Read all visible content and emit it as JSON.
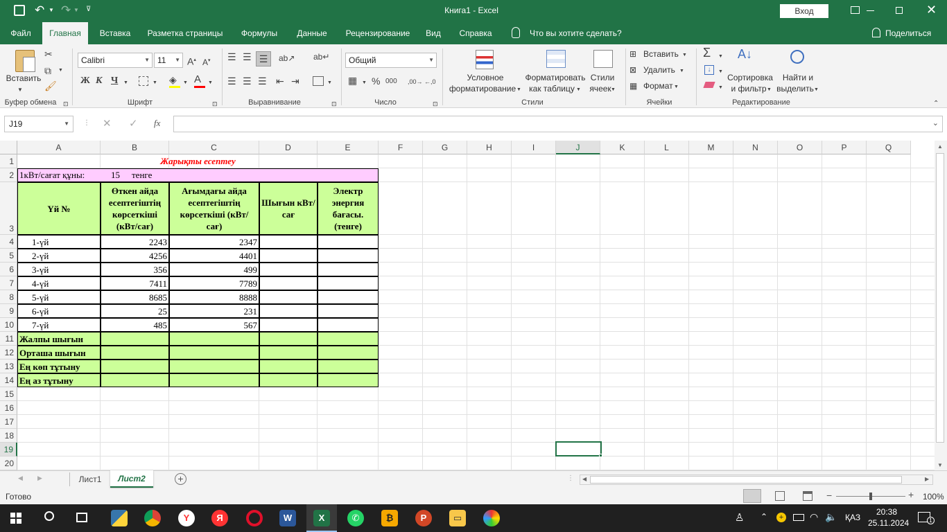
{
  "window": {
    "title": "Книга1  -  Excel",
    "signin": "Вход"
  },
  "ribbon_tabs": [
    {
      "label": "Файл"
    },
    {
      "label": "Главная"
    },
    {
      "label": "Вставка"
    },
    {
      "label": "Разметка страницы"
    },
    {
      "label": "Формулы"
    },
    {
      "label": "Данные"
    },
    {
      "label": "Рецензирование"
    },
    {
      "label": "Вид"
    },
    {
      "label": "Справка"
    }
  ],
  "tellme": "Что вы хотите сделать?",
  "share": "Поделиться",
  "ribbon": {
    "paste": "Вставить",
    "font_name": "Calibri",
    "font_size": "11",
    "bold": "Ж",
    "italic": "К",
    "underline": "Ч",
    "number_format": "Общий",
    "cond_format_1": "Условное",
    "cond_format_2": "форматирование",
    "fmt_table_1": "Форматировать",
    "fmt_table_2": "как таблицу",
    "cell_styles_1": "Стили",
    "cell_styles_2": "ячеек",
    "insert": "Вставить",
    "delete": "Удалить",
    "format": "Формат",
    "sort_1": "Сортировка",
    "sort_2": "и фильтр",
    "find_1": "Найти и",
    "find_2": "выделить",
    "groups": {
      "clipboard": "Буфер обмена",
      "font": "Шрифт",
      "alignment": "Выравнивание",
      "number": "Число",
      "styles": "Стили",
      "cells": "Ячейки",
      "editing": "Редактирование"
    }
  },
  "formula_bar": {
    "name_box": "J19",
    "fx": "fx",
    "content": ""
  },
  "columns": [
    "A",
    "B",
    "C",
    "D",
    "E",
    "F",
    "G",
    "H",
    "I",
    "J",
    "K",
    "L",
    "M",
    "N",
    "O",
    "P",
    "Q"
  ],
  "rows": [
    "1",
    "2",
    "3",
    "4",
    "5",
    "6",
    "7",
    "8",
    "9",
    "10",
    "11",
    "12",
    "13",
    "14",
    "15",
    "16",
    "17",
    "18",
    "19",
    "20"
  ],
  "table": {
    "title": "Жарықты есептеу",
    "rate_label": "1кВт/сағат құны:",
    "rate_value": "15",
    "rate_unit": "тенге",
    "headers": {
      "a": "Үй №",
      "b": "Өткен айда есептегіштің көрсеткіші (кВт/сағ)",
      "c": "Ағымдағы айда есептегіштің көрсеткіші (кВт/сағ)",
      "d": "Шығын кВт/сағ",
      "e": "Электр энергия бағасы. (тенге)"
    },
    "data": [
      {
        "house": "1-үй",
        "prev": "2243",
        "curr": "2347"
      },
      {
        "house": "2-үй",
        "prev": "4256",
        "curr": "4401"
      },
      {
        "house": "3-үй",
        "prev": "356",
        "curr": "499"
      },
      {
        "house": "4-үй",
        "prev": "7411",
        "curr": "7789"
      },
      {
        "house": "5-үй",
        "prev": "8685",
        "curr": "8888"
      },
      {
        "house": "6-үй",
        "prev": "25",
        "curr": "231"
      },
      {
        "house": "7-үй",
        "prev": "485",
        "curr": "567"
      }
    ],
    "summary": [
      "Жалпы шығын",
      "Орташа шығын",
      "Ең көп тұтыну",
      "Ең аз тұтыну"
    ]
  },
  "sheets": [
    {
      "label": "Лист1"
    },
    {
      "label": "Лист2"
    }
  ],
  "status": {
    "ready": "Готово",
    "zoom": "100%"
  },
  "taskbar": {
    "lang": "ҚАЗ",
    "time": "20:38",
    "date": "25.11.2024"
  },
  "colors": {
    "excel_green": "#217346",
    "header_fill": "#ccff99",
    "pink_fill": "#ffccff",
    "title_red": "#ff0000"
  }
}
